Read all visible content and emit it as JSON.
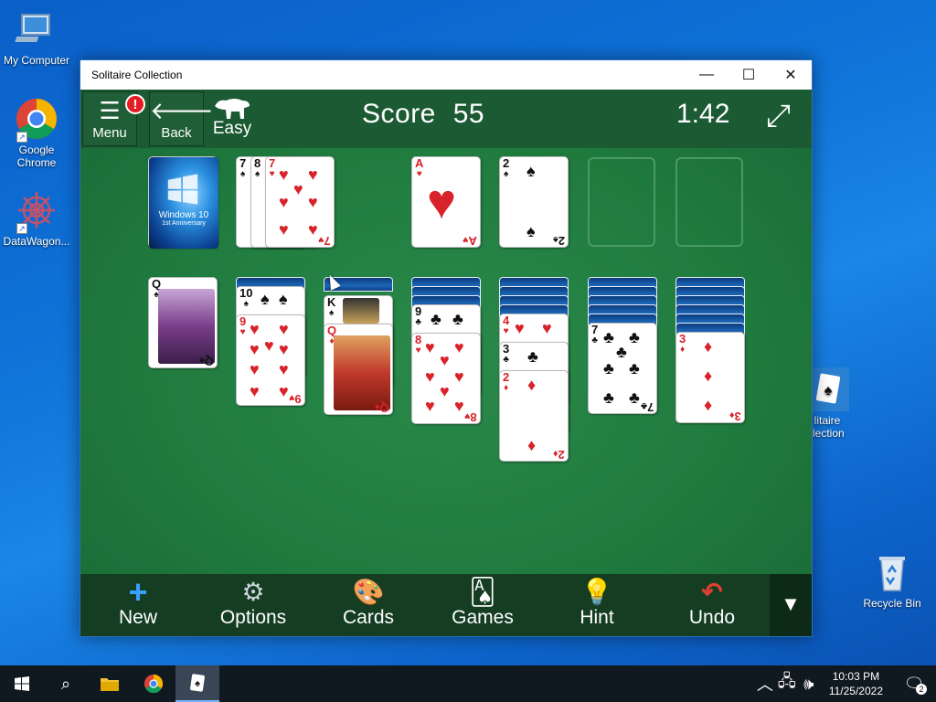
{
  "desktop": {
    "icons": [
      {
        "label": "My Computer",
        "icon": "computer-icon"
      },
      {
        "label": "Google Chrome",
        "icon": "chrome-icon"
      },
      {
        "label": "DataWagon...",
        "icon": "datawagon-icon"
      },
      {
        "label": "Solitaire Collection",
        "visible_text": "litaire\nllection",
        "icon": "solitaire-icon"
      },
      {
        "label": "Recycle Bin",
        "icon": "recycle-bin-icon"
      }
    ]
  },
  "window": {
    "title": "Solitaire Collection",
    "controls": {
      "minimize": "—",
      "maximize": "☐",
      "close": "✕"
    }
  },
  "game": {
    "menu_label": "Menu",
    "menu_badge": "!",
    "back_label": "Back",
    "difficulty": "Easy",
    "score_label": "Score",
    "score_value": "55",
    "timer": "1:42"
  },
  "cards": {
    "stock": {
      "line1": "Windows 10",
      "line2": "1st Anniversary"
    },
    "waste": [
      {
        "rank": "7",
        "suit": "♠"
      },
      {
        "rank": "8",
        "suit": "♠"
      },
      {
        "rank": "7",
        "suit": "♥"
      }
    ],
    "foundations": [
      {
        "rank": "A",
        "suit": "♥"
      },
      {
        "rank": "2",
        "suit": "♠"
      }
    ],
    "tableau": [
      {
        "faceup": [
          {
            "rank": "Q",
            "suit": "♠"
          }
        ]
      },
      {
        "faceup": [
          {
            "rank": "10",
            "suit": "♠"
          },
          {
            "rank": "9",
            "suit": "♥"
          }
        ]
      },
      {
        "faceup": [
          {
            "rank": "K",
            "suit": "♠"
          },
          {
            "rank": "Q",
            "suit": "♦"
          }
        ]
      },
      {
        "faceup": [
          {
            "rank": "9",
            "suit": "♣"
          },
          {
            "rank": "8",
            "suit": "♥"
          }
        ]
      },
      {
        "faceup": [
          {
            "rank": "4",
            "suit": "♥"
          },
          {
            "rank": "3",
            "suit": "♣"
          },
          {
            "rank": "2",
            "suit": "♦"
          }
        ]
      },
      {
        "faceup": [
          {
            "rank": "7",
            "suit": "♣"
          }
        ]
      },
      {
        "faceup": [
          {
            "rank": "3",
            "suit": "♦"
          }
        ]
      }
    ]
  },
  "bottombar": {
    "items": [
      {
        "label": "New",
        "icon": "plus-icon"
      },
      {
        "label": "Options",
        "icon": "gear-icon"
      },
      {
        "label": "Cards",
        "icon": "palette-icon"
      },
      {
        "label": "Games",
        "icon": "cards-icon"
      },
      {
        "label": "Hint",
        "icon": "lightbulb-icon"
      },
      {
        "label": "Undo",
        "icon": "undo-icon"
      }
    ],
    "more": "▼"
  },
  "taskbar": {
    "time": "10:03 PM",
    "date": "11/25/2022",
    "notifications": "2"
  },
  "colors": {
    "felt": "#1f7a3e",
    "topbar": "#1b5a33",
    "bottombar": "#143d22",
    "red_suit": "#d8232a",
    "desktop": "#0f73d8"
  }
}
